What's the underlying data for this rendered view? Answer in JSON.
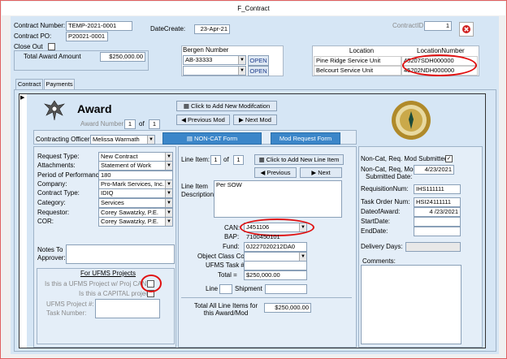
{
  "window": {
    "title": "F_Contract"
  },
  "header": {
    "contract_number_label": "Contract Number:",
    "contract_number": "TEMP-2021-0001",
    "contract_po_label": "Contract PO:",
    "contract_po": "P20021-0001",
    "close_out_label": "Close Out",
    "total_award_label": "Total Award Amount",
    "total_award": "$250,000.00",
    "date_create_label": "DateCreate:",
    "date_create": "23-Apr-21",
    "contract_id_label": "ContractID",
    "contract_id": "1"
  },
  "bergen": {
    "title": "Bergen Number",
    "rows": [
      {
        "value": "AB-33333",
        "button": "OPEN"
      },
      {
        "value": "",
        "button": "OPEN"
      }
    ]
  },
  "locations": {
    "col_location": "Location",
    "col_number": "LocationNumber",
    "rows": [
      {
        "location": "Pine Ridge Service Unit",
        "number": "45207SDH000000"
      },
      {
        "location": "Belcourt Service Unit",
        "number": "45202NDH000000"
      }
    ]
  },
  "tabs": [
    {
      "label": "Contract"
    },
    {
      "label": "Payments"
    }
  ],
  "award": {
    "title": "Award",
    "number_label": "Award Number:",
    "number": "1",
    "of_label": "of",
    "of_value": "1",
    "add_mod_button": "Click to Add New Modifcation",
    "prev_mod_button": "Previous Mod",
    "next_mod_button": "Next Mod",
    "contracting_officer_label": "Contracting Officer:",
    "contracting_officer": "Melissa Warmath",
    "noncat_button": "NON-CAT Form",
    "mod_request_button": "Mod Request Form"
  },
  "details": {
    "request_type_label": "Request Type:",
    "request_type": "New Contract",
    "attachments_label": "Attachments:",
    "attachments": "Statement of Work",
    "period_label": "Period of Performance:",
    "period": "180",
    "company_label": "Company:",
    "company": "Pro-Mark Services, Inc.",
    "contract_type_label": "Contract Type:",
    "contract_type": "IDIQ",
    "category_label": "Category:",
    "category": "Services",
    "requestor_label": "Requestor:",
    "requestor": "Corey Sawatzky, P.E.",
    "cor_label": "COR:",
    "cor": "Corey Sawatzky, P.E.",
    "notes_label": "Notes To Approver:"
  },
  "ufms": {
    "title": "For UFMS Projects",
    "q1": "Is this a UFMS Project w/ Proj CAN?",
    "q2": "Is this a CAPITAL project?",
    "project_label": "UFMS Project #:",
    "task_label": "Task Number:"
  },
  "line_item": {
    "label": "Line Item:",
    "value": "1",
    "of_label": "of",
    "of_value": "1",
    "add_button": "Click to Add New Line Item",
    "prev_button": "Previous",
    "next_button": "Next",
    "desc_label": "Line Item Description",
    "desc": "Per SOW",
    "can_label": "CAN:",
    "can": "J451106",
    "bap_label": "BAP:",
    "bap": "7100450101",
    "fund_label": "Fund:",
    "fund": "0J227020212DA0",
    "occ_label": "Object Class Code",
    "ufms_task_label": "UFMS Task #:",
    "total_label": "Total =",
    "total": "$250,000.00",
    "line_label": "Line",
    "shipment_label": "Shipment",
    "all_total_label": "Total All Line Items for this Award/Mod",
    "all_total": "$250,000.00"
  },
  "right": {
    "noncat_submitted_label": "Non-Cat, Req. Mod Submitted:",
    "noncat_date_label": "Non-Cat, Req, Mod Submitted Date:",
    "noncat_date": "4/23/2021",
    "requisition_label": "RequisitionNum:",
    "requisition": "IHS111111",
    "task_order_label": "Task Order Num:",
    "task_order": "HSI24111111",
    "date_award_label": "DateofAward:",
    "date_award": "4 /23/2021",
    "start_label": "StartDate:",
    "end_label": "EndDate:",
    "delivery_label": "Delivery Days:",
    "comments_label": "Comments:"
  },
  "colors": {
    "form_bg": "#d6e6f5",
    "accent_blue": "#3b86c9",
    "highlight_red": "#e01010"
  }
}
